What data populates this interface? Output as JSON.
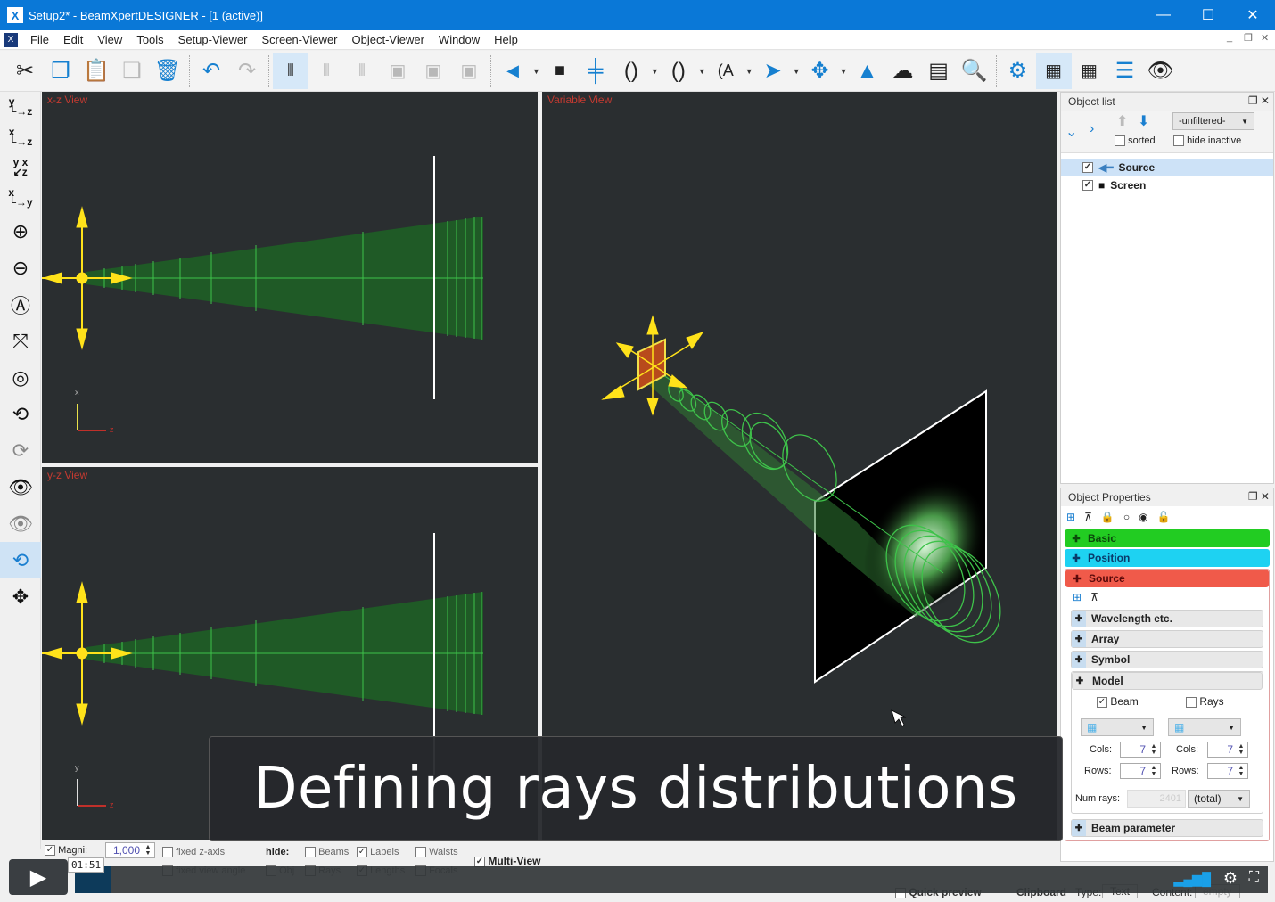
{
  "window": {
    "title": "Setup2* - BeamXpertDESIGNER  - [1 (active)]",
    "controls": {
      "minimize": "—",
      "maximize": "☐",
      "close": "✕"
    }
  },
  "menu": {
    "items": [
      "File",
      "Edit",
      "View",
      "Tools",
      "Setup-Viewer",
      "Screen-Viewer",
      "Object-Viewer",
      "Window",
      "Help"
    ],
    "mdi_controls": {
      "minimize": "_",
      "restore": "❐",
      "close": "✕"
    }
  },
  "toolbar": {
    "icons": [
      "cut-icon",
      "copy-icon",
      "paste-icon",
      "paste-special-icon",
      "delete-icon",
      "undo-icon",
      "redo-icon",
      "select-optics-icon",
      "optics-group-icon",
      "optics-edit-icon",
      "image-open-icon",
      "image-export-icon",
      "image-save-icon",
      "source-icon",
      "screen-icon",
      "aperture-icon",
      "lens-icon",
      "thick-lens-icon",
      "aspheric-lens-icon",
      "mirror-icon",
      "beam-splitter-icon",
      "prism-icon",
      "fiber-icon",
      "report-icon",
      "search-report-icon",
      "settings-icon",
      "calc-beam-icon",
      "calc-icon",
      "ray-calc-icon",
      "visibility-icon"
    ]
  },
  "left_tools": {
    "axis_views": [
      "y-z",
      "x-z",
      "xyz",
      "x-y"
    ],
    "icons": [
      "zoom-in-icon",
      "zoom-out-icon",
      "zoom-all-icon",
      "fit-center-icon",
      "zoom-target-icon",
      "zoom-undo-icon",
      "zoom-redo-icon",
      "view-copy-icon",
      "view-paste-icon",
      "rotate-icon",
      "pan-icon"
    ]
  },
  "views": {
    "xz": {
      "label": "x-z View",
      "axis_vertical": "x",
      "axis_horizontal": "z"
    },
    "yz": {
      "label": "y-z View",
      "axis_vertical": "y",
      "axis_horizontal": "z"
    },
    "var": {
      "label": "Variable View"
    }
  },
  "object_list": {
    "title": "Object list",
    "filter": "-unfiltered-",
    "sorted_label": "sorted",
    "sorted": false,
    "hide_inactive_label": "hide inactive",
    "hide_inactive": false,
    "items": [
      {
        "name": "Source",
        "checked": true,
        "selected": true
      },
      {
        "name": "Screen",
        "checked": true,
        "selected": false
      }
    ]
  },
  "object_properties": {
    "title": "Object Properties",
    "sections": [
      {
        "label": "Basic",
        "color": "#22cc22"
      },
      {
        "label": "Position",
        "color": "#1ed2f2"
      },
      {
        "label": "Source",
        "color": "#f05a4a"
      }
    ],
    "subsections": [
      "Wavelength etc.",
      "Array",
      "Symbol",
      "Model"
    ],
    "model": {
      "beam_label": "Beam",
      "beam_checked": true,
      "rays_label": "Rays",
      "rays_checked": false,
      "cols_label": "Cols:",
      "rows_label": "Rows:",
      "beam_cols": "7",
      "beam_rows": "7",
      "rays_cols": "7",
      "rays_rows": "7",
      "num_rays_label": "Num rays:",
      "num_rays": "2401",
      "num_rays_mode": "(total)"
    },
    "beam_parameter_label": "Beam parameter"
  },
  "bottom": {
    "magni_label": "Magni:",
    "magni_checked": true,
    "magni_value": "1,000",
    "fixed_z_axis": "fixed z-axis",
    "fixed_view_angle": "fixed view angle",
    "hide_label": "hide:",
    "hide_options": [
      {
        "label": "Beams",
        "checked": false
      },
      {
        "label": "Labels",
        "checked": true
      },
      {
        "label": "Waists",
        "checked": false
      },
      {
        "label": "Obj",
        "checked": false
      },
      {
        "label": "Rays",
        "checked": false
      },
      {
        "label": "Lengths",
        "checked": true
      },
      {
        "label": "Focals",
        "checked": false
      }
    ],
    "multi_view_label": "Multi-View",
    "multi_view_checked": true
  },
  "status": {
    "quick_preview": "Quick preview",
    "clipboard_label": "Clipboard",
    "type_label": "Type:",
    "type_value": "Text",
    "content_label": "Content:",
    "content_value": "empty"
  },
  "video": {
    "caption": "Defining rays distributions",
    "time": "01:51",
    "progress_fraction": 0.03
  }
}
